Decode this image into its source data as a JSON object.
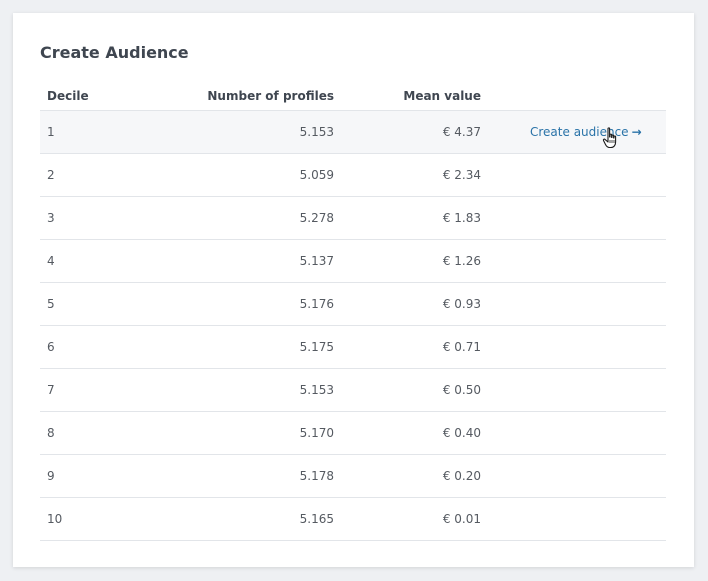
{
  "card": {
    "title": "Create Audience"
  },
  "table": {
    "headers": {
      "decile": "Decile",
      "profiles": "Number of profiles",
      "mean": "Mean value"
    },
    "rows": [
      {
        "decile": "1",
        "profiles": "5.153",
        "mean": "€ 4.37"
      },
      {
        "decile": "2",
        "profiles": "5.059",
        "mean": "€ 2.34"
      },
      {
        "decile": "3",
        "profiles": "5.278",
        "mean": "€ 1.83"
      },
      {
        "decile": "4",
        "profiles": "5.137",
        "mean": "€ 1.26"
      },
      {
        "decile": "5",
        "profiles": "5.176",
        "mean": "€ 0.93"
      },
      {
        "decile": "6",
        "profiles": "5.175",
        "mean": "€ 0.71"
      },
      {
        "decile": "7",
        "profiles": "5.153",
        "mean": "€ 0.50"
      },
      {
        "decile": "8",
        "profiles": "5.170",
        "mean": "€ 0.40"
      },
      {
        "decile": "9",
        "profiles": "5.178",
        "mean": "€ 0.20"
      },
      {
        "decile": "10",
        "profiles": "5.165",
        "mean": "€ 0.01"
      }
    ],
    "action": {
      "label": "Create audience",
      "icon": "arrow-right-icon",
      "arrow": "→"
    }
  },
  "colors": {
    "link": "#2a73a8",
    "highlight_row": "#f6f7f9",
    "divider": "#e2e5e9"
  }
}
